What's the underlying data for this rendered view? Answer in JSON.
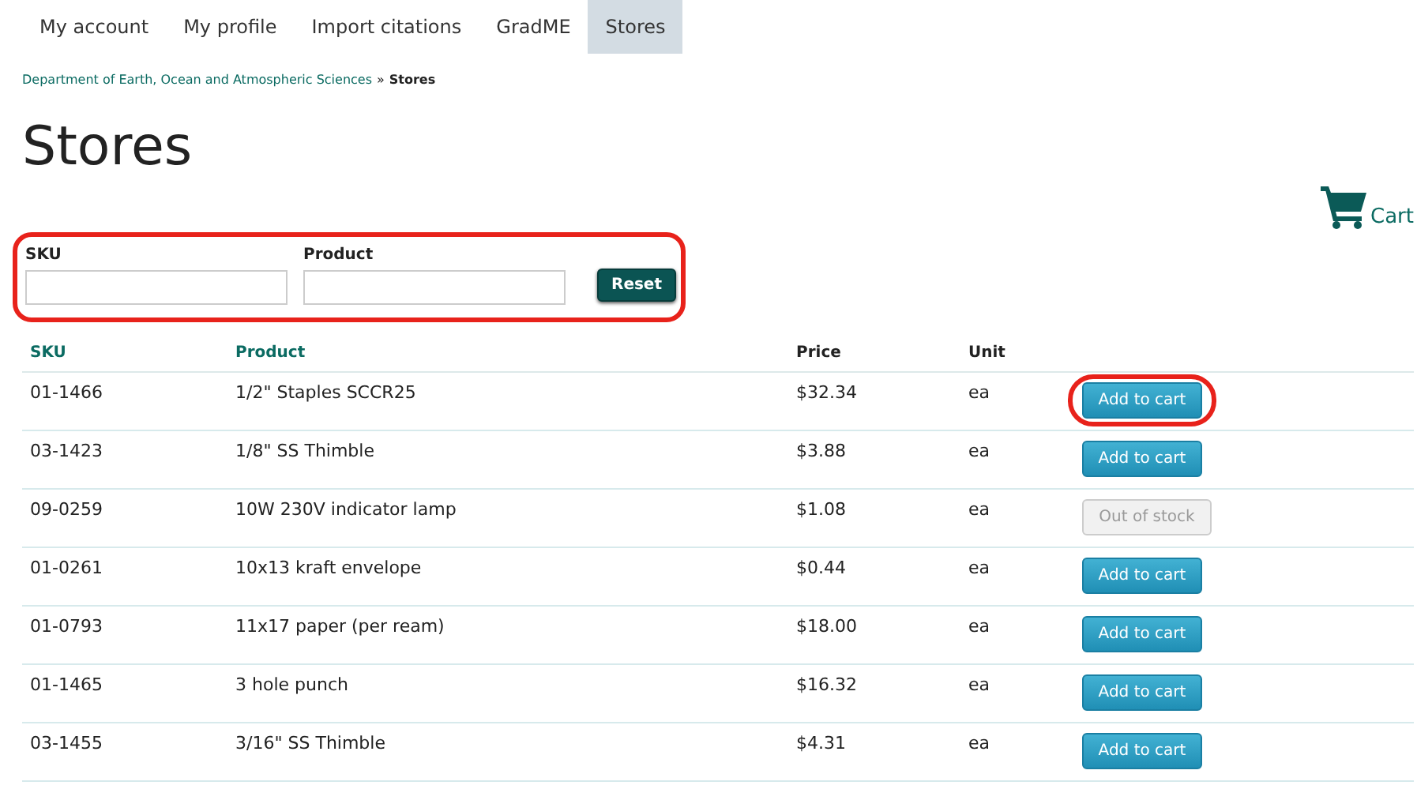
{
  "tabs": [
    {
      "label": "My account",
      "selected": false
    },
    {
      "label": "My profile",
      "selected": false
    },
    {
      "label": "Import citations",
      "selected": false
    },
    {
      "label": "GradME",
      "selected": false
    },
    {
      "label": "Stores",
      "selected": true
    }
  ],
  "breadcrumb": {
    "link": "Department of Earth, Ocean and Atmospheric Sciences",
    "separator": "»",
    "current": "Stores"
  },
  "title": "Stores",
  "cart": {
    "label": "Cart"
  },
  "filters": {
    "annotated": true,
    "fields": [
      {
        "label": "SKU"
      },
      {
        "label": "Product"
      }
    ],
    "reset": "Reset"
  },
  "table": {
    "columns": [
      "SKU",
      "Product",
      "Price",
      "Unit"
    ],
    "rows": [
      {
        "sku": "01-1466",
        "product": "1/2\" Staples SCCR25",
        "price": "$32.34",
        "unit": "ea",
        "button": "Add to cart",
        "disabled": false,
        "annotated": true
      },
      {
        "sku": "03-1423",
        "product": "1/8\" SS Thimble",
        "price": "$3.88",
        "unit": "ea",
        "button": "Add to cart",
        "disabled": false,
        "annotated": false
      },
      {
        "sku": "09-0259",
        "product": "10W 230V indicator lamp",
        "price": "$1.08",
        "unit": "ea",
        "button": "Out of stock",
        "disabled": true,
        "annotated": false
      },
      {
        "sku": "01-0261",
        "product": "10x13 kraft envelope",
        "price": "$0.44",
        "unit": "ea",
        "button": "Add to cart",
        "disabled": false,
        "annotated": false
      },
      {
        "sku": "01-0793",
        "product": "11x17 paper (per ream)",
        "price": "$18.00",
        "unit": "ea",
        "button": "Add to cart",
        "disabled": false,
        "annotated": false
      },
      {
        "sku": "01-1465",
        "product": "3 hole punch",
        "price": "$16.32",
        "unit": "ea",
        "button": "Add to cart",
        "disabled": false,
        "annotated": false
      },
      {
        "sku": "03-1455",
        "product": "3/16\" SS Thimble",
        "price": "$4.31",
        "unit": "ea",
        "button": "Add to cart",
        "disabled": false,
        "annotated": false
      }
    ]
  }
}
